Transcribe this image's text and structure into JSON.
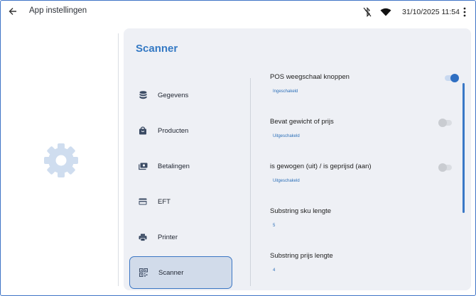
{
  "header": {
    "title": "App instellingen",
    "datetime": "31/10/2025  11:54"
  },
  "panel": {
    "title": "Scanner"
  },
  "nav": {
    "items": [
      {
        "label": "Gegevens",
        "icon": "database-icon"
      },
      {
        "label": "Producten",
        "icon": "shopping-bag-icon"
      },
      {
        "label": "Betalingen",
        "icon": "payments-icon"
      },
      {
        "label": "EFT",
        "icon": "credit-card-icon"
      },
      {
        "label": "Printer",
        "icon": "printer-icon"
      },
      {
        "label": "Scanner",
        "icon": "qr-code-icon",
        "active": true
      }
    ]
  },
  "settings": [
    {
      "label": "POS weegschaal knoppen",
      "value": "Ingeschakeld",
      "toggle": true
    },
    {
      "label": "Bevat gewicht of prijs",
      "value": "Uitgeschakeld",
      "toggle": false
    },
    {
      "label": "is gewogen (uit) / is geprijsd (aan)",
      "value": "Uitgeschakeld",
      "toggle": false
    },
    {
      "label": "Substring sku lengte",
      "value": "5"
    },
    {
      "label": "Substring prijs lengte",
      "value": "4"
    }
  ],
  "colors": {
    "accent": "#3479c4",
    "panel_bg": "#eef0f5",
    "active_nav_bg": "#d1dbea"
  }
}
